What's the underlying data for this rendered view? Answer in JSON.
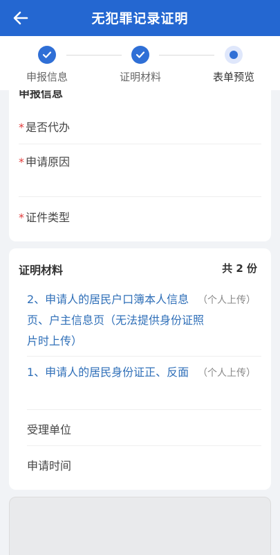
{
  "header": {
    "title": "无犯罪记录证明"
  },
  "steps": [
    {
      "label": "申报信息",
      "state": "done"
    },
    {
      "label": "证明材料",
      "state": "done"
    },
    {
      "label": "表单预览",
      "state": "current"
    }
  ],
  "form": {
    "partial_heading": "申报信息",
    "fields": [
      {
        "label": "是否代办",
        "required": true
      },
      {
        "label": "申请原因",
        "required": true
      },
      {
        "label": "证件类型",
        "required": true
      }
    ]
  },
  "materials": {
    "title": "证明材料",
    "count": "共 2 份",
    "items": [
      {
        "name": "2、申请人的居民户口簿本人信息页、户主信息页（无法提供身份证照片时上传）",
        "tag": "（个人上传）"
      },
      {
        "name": "1、申请人的居民身份证正、反面",
        "tag": "（个人上传）"
      }
    ],
    "extra_fields": [
      {
        "label": "受理单位"
      },
      {
        "label": "申请时间"
      }
    ]
  },
  "colors": {
    "header_bg": "#2467d1",
    "accent": "#2f6fd6",
    "link_text": "#2f6fb8",
    "required_mark": "#e23b3b",
    "page_bg": "#f1f3f6"
  },
  "icons": {
    "back": "arrow-left-icon",
    "step_done": "check-icon",
    "step_current": "dot-icon"
  }
}
